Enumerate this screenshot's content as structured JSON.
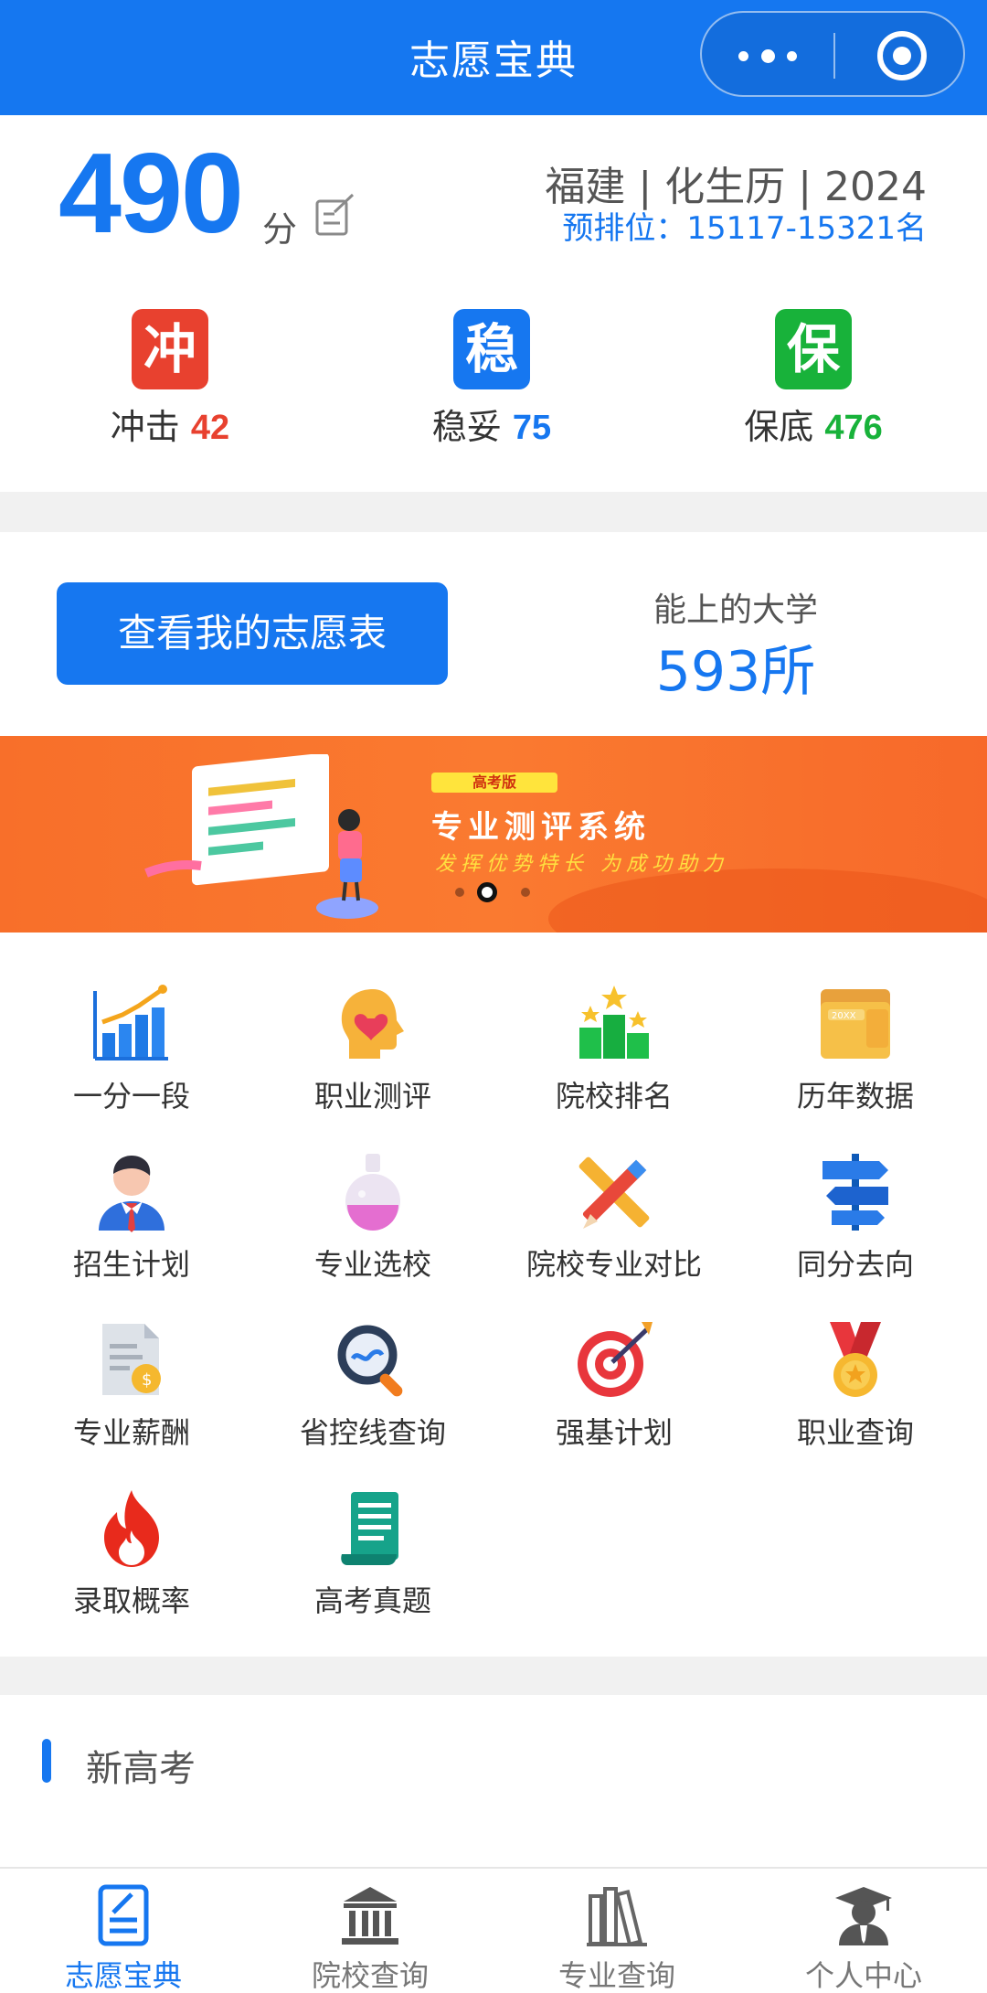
{
  "header": {
    "title": "志愿宝典"
  },
  "score": {
    "value": "490",
    "unit": "分",
    "region": "福建 | 化生历 | 2024",
    "rank": "预排位：15117-15321名"
  },
  "levels": [
    {
      "badge": "冲",
      "label": "冲击",
      "count": "42",
      "color": "#e8412f"
    },
    {
      "badge": "稳",
      "label": "稳妥",
      "count": "75",
      "color": "#1677f0"
    },
    {
      "badge": "保",
      "label": "保底",
      "count": "476",
      "color": "#18b23a"
    }
  ],
  "form": {
    "button_label": "查看我的志愿表",
    "univ_label": "能上的大学",
    "univ_count": "593所"
  },
  "banner": {
    "tag": "高考版",
    "title": "专业测评系统",
    "subtitle": "发挥优势特长 为成功助力",
    "slide_index": 2,
    "slide_total": 3
  },
  "tools": [
    {
      "label": "一分一段",
      "icon": "bar-chart-icon"
    },
    {
      "label": "职业测评",
      "icon": "head-heart-icon"
    },
    {
      "label": "院校排名",
      "icon": "podium-icon"
    },
    {
      "label": "历年数据",
      "icon": "calendar-folder-icon"
    },
    {
      "label": "招生计划",
      "icon": "person-tie-icon"
    },
    {
      "label": "专业选校",
      "icon": "flask-icon"
    },
    {
      "label": "院校专业对比",
      "icon": "pencil-ruler-icon"
    },
    {
      "label": "同分去向",
      "icon": "signpost-icon"
    },
    {
      "label": "专业薪酬",
      "icon": "document-coin-icon"
    },
    {
      "label": "省控线查询",
      "icon": "magnifier-icon"
    },
    {
      "label": "强基计划",
      "icon": "target-icon"
    },
    {
      "label": "职业查询",
      "icon": "medal-icon"
    },
    {
      "label": "录取概率",
      "icon": "flame-icon"
    },
    {
      "label": "高考真题",
      "icon": "scroll-icon"
    }
  ],
  "section": {
    "title": "新高考"
  },
  "tabbar": [
    {
      "label": "志愿宝典",
      "icon": "notebook-icon",
      "active": true
    },
    {
      "label": "院校查询",
      "icon": "building-icon",
      "active": false
    },
    {
      "label": "专业查询",
      "icon": "books-icon",
      "active": false
    },
    {
      "label": "个人中心",
      "icon": "graduate-icon",
      "active": false
    }
  ],
  "colors": {
    "primary": "#1677f0",
    "reach": "#e8412f",
    "safe": "#18b23a",
    "banner": "#f8722c"
  }
}
